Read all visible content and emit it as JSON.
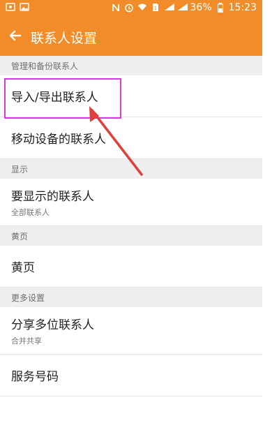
{
  "status_bar": {
    "left_icons": [
      "photo-icon",
      "image-icon"
    ],
    "battery": "36%",
    "time": "15:23"
  },
  "header": {
    "title": "联系人设置"
  },
  "sections": {
    "manage": {
      "header": "管理和备份联系人",
      "items": [
        {
          "label": "导入/导出联系人"
        },
        {
          "label": "移动设备的联系人"
        }
      ]
    },
    "display": {
      "header": "显示",
      "items": [
        {
          "label": "要显示的联系人",
          "sub": "全部联系人"
        }
      ]
    },
    "yellowpages": {
      "header": "黄页",
      "items": [
        {
          "label": "黄页"
        }
      ]
    },
    "more": {
      "header": "更多设置",
      "items": [
        {
          "label": "分享多位联系人",
          "sub": "合并共享"
        },
        {
          "label": "服务号码"
        }
      ]
    }
  },
  "colors": {
    "accent": "#f28c28",
    "highlight": "#d43be0",
    "arrow": "#e0403a"
  }
}
